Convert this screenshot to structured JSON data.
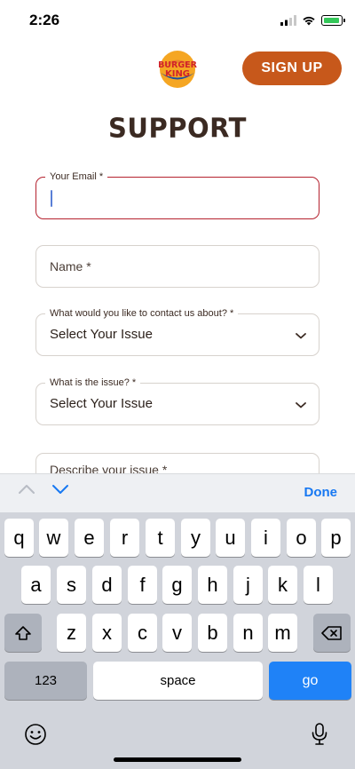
{
  "status_bar": {
    "time": "2:26"
  },
  "header": {
    "signup_label": "SIGN UP",
    "logo_text_top": "BURGER",
    "logo_text_bottom": "KING"
  },
  "page": {
    "title": "SUPPORT"
  },
  "form": {
    "email": {
      "label": "Your Email *",
      "value": ""
    },
    "name": {
      "placeholder": "Name *"
    },
    "contact_topic": {
      "label": "What would you like to contact us about? *",
      "value": "Select Your Issue"
    },
    "issue": {
      "label": "What is the issue? *",
      "value": "Select Your Issue"
    },
    "describe": {
      "placeholder": "Describe your issue *"
    }
  },
  "keyboard_toolbar": {
    "done_label": "Done"
  },
  "keyboard": {
    "row1": [
      "q",
      "w",
      "e",
      "r",
      "t",
      "y",
      "u",
      "i",
      "o",
      "p"
    ],
    "row2": [
      "a",
      "s",
      "d",
      "f",
      "g",
      "h",
      "j",
      "k",
      "l"
    ],
    "row3": [
      "z",
      "x",
      "c",
      "v",
      "b",
      "n",
      "m"
    ],
    "numbers_label": "123",
    "space_label": "space",
    "go_label": "go"
  },
  "colors": {
    "brand_orange": "#c7581b",
    "error_red": "#b5222f",
    "ios_blue": "#1f82f7"
  }
}
